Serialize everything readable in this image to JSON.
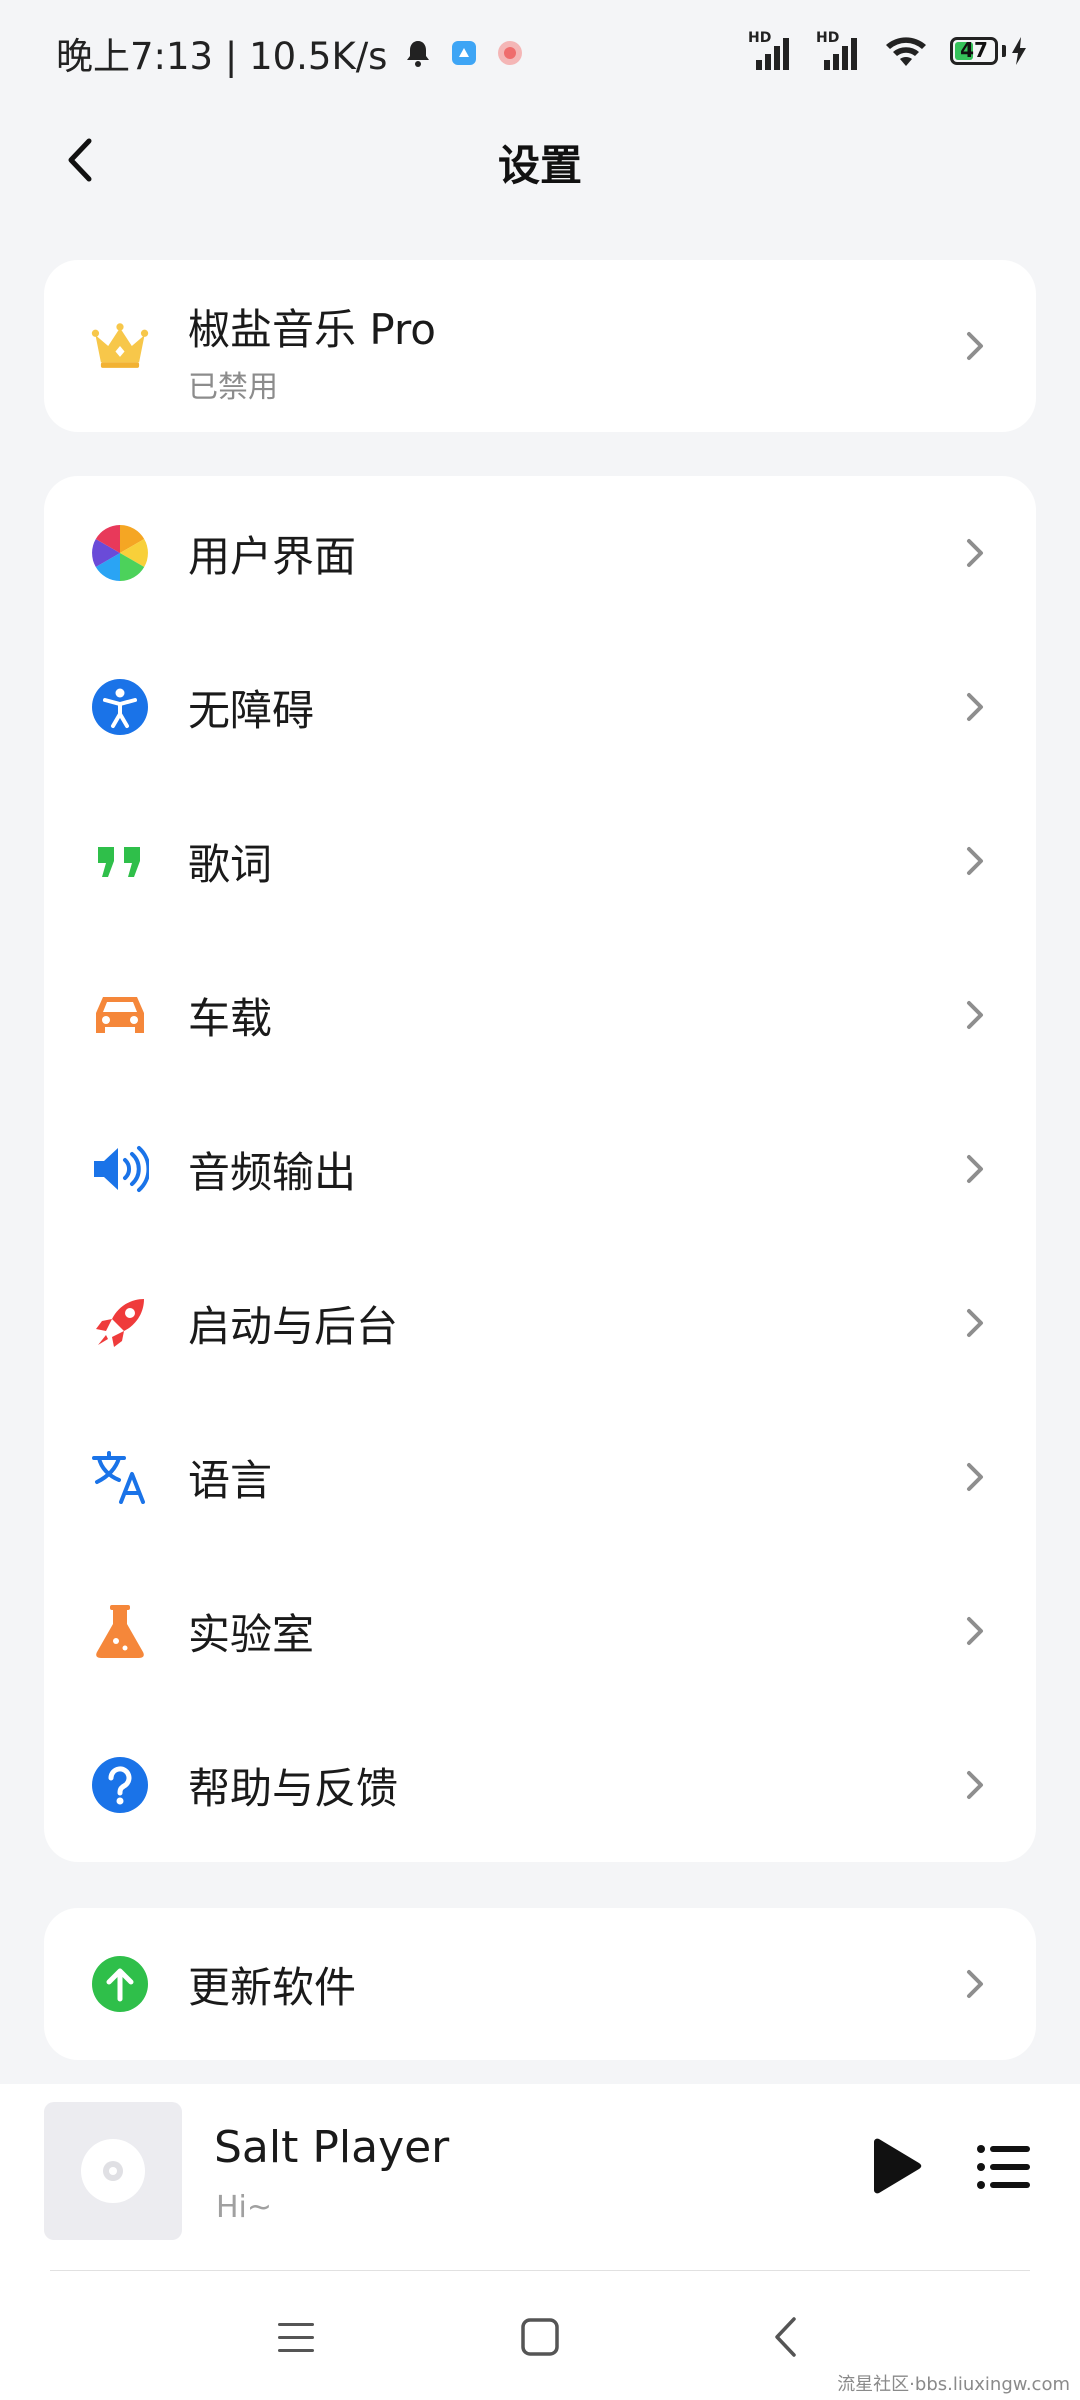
{
  "status_bar": {
    "time_speed": "晚上7:13 | 10.5K/s",
    "battery": "47",
    "network_labels": [
      "HD",
      "HD"
    ]
  },
  "header": {
    "title": "设置"
  },
  "pro": {
    "label": "椒盐音乐 Pro",
    "status": "已禁用",
    "icon": "crown-icon"
  },
  "settings": [
    {
      "label": "用户界面",
      "icon": "color-wheel-icon"
    },
    {
      "label": "无障碍",
      "icon": "accessibility-icon",
      "color": "#1a73e8"
    },
    {
      "label": "歌词",
      "icon": "quote-icon",
      "color": "#2fbf4a"
    },
    {
      "label": "车载",
      "icon": "car-icon",
      "color": "#f5873a"
    },
    {
      "label": "音频输出",
      "icon": "speaker-icon",
      "color": "#1a73e8"
    },
    {
      "label": "启动与后台",
      "icon": "rocket-icon",
      "color": "#ef3b3b"
    },
    {
      "label": "语言",
      "icon": "translate-icon",
      "color": "#1a73e8"
    },
    {
      "label": "实验室",
      "icon": "flask-icon",
      "color": "#f5873a"
    },
    {
      "label": "帮助与反馈",
      "icon": "help-icon",
      "color": "#1a73e8"
    }
  ],
  "update": {
    "label": "更新软件",
    "icon": "arrow-up-circle-icon",
    "color": "#2fbf4a"
  },
  "player": {
    "song": "Salt Player",
    "artist": "Hi~"
  },
  "watermark": "流星社区·bbs.liuxingw.com"
}
